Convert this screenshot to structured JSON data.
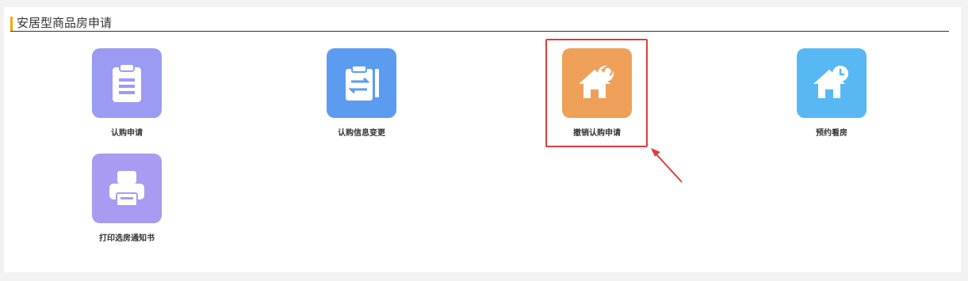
{
  "section": {
    "title": "安居型商品房申请"
  },
  "tiles": [
    {
      "label": "认购申请",
      "icon": "clipboard-icon",
      "color": "#9b9bf4"
    },
    {
      "label": "认购信息变更",
      "icon": "exchange-document-icon",
      "color": "#5b9cf0"
    },
    {
      "label": "撤销认购申请",
      "icon": "house-undo-icon",
      "color": "#eea058"
    },
    {
      "label": "预约看房",
      "icon": "house-clock-icon",
      "color": "#58b8f4"
    },
    {
      "label": "打印选房通知书",
      "icon": "printer-icon",
      "color": "#a99af2"
    }
  ],
  "annotation": {
    "color": "#e23b3b"
  }
}
